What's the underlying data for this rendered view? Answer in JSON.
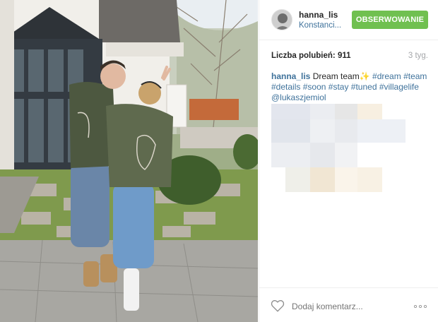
{
  "post": {
    "username": "hanna_lis",
    "location": "Konstanci...",
    "follow_label": "OBSERWOWANIE",
    "likes_label": "Liczba polubień:",
    "likes_count": "911",
    "time_ago": "3 tyg.",
    "caption": {
      "author": "hanna_lis",
      "text": "Dream team",
      "emoji": "✨",
      "tags": [
        "#dream",
        "#team",
        "#details",
        "#soon",
        "#stay",
        "#tuned",
        "#villagelife"
      ],
      "mention": "@lukaszjemiol"
    },
    "comment_placeholder": "Dodaj komentarz...",
    "icons": {
      "like": "heart-outline-icon",
      "more": "more-options-icon"
    },
    "colors": {
      "follow_button": "#70c050",
      "link": "#3f729b",
      "muted": "#a5a7aa"
    }
  }
}
